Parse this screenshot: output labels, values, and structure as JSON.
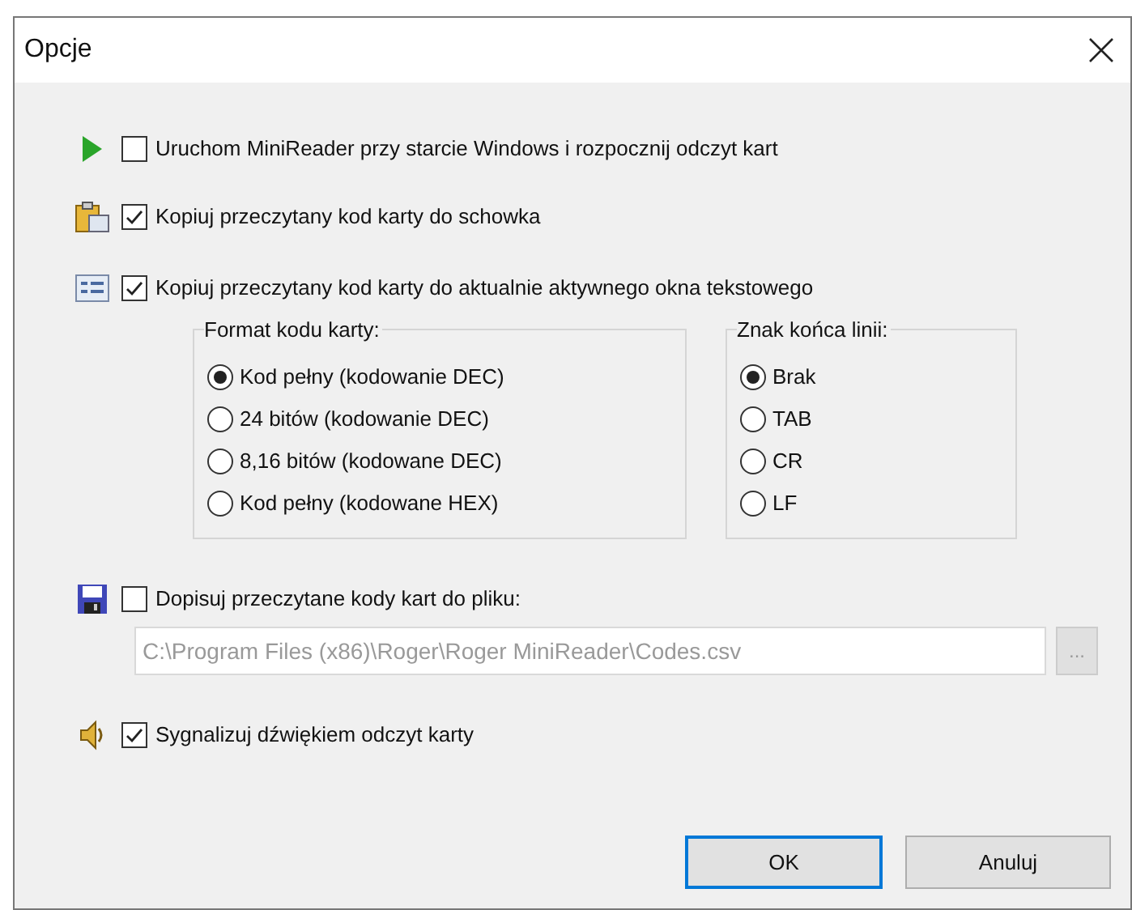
{
  "window": {
    "title": "Opcje"
  },
  "startup": {
    "label": "Uruchom MiniReader przy starcie Windows i rozpocznij odczyt kart",
    "checked": false
  },
  "clipboard": {
    "label": "Kopiuj przeczytany kod karty do schowka",
    "checked": true
  },
  "active_window": {
    "label": "Kopiuj przeczytany kod karty do aktualnie aktywnego okna tekstowego",
    "checked": true
  },
  "code_format": {
    "title": "Format kodu karty:",
    "options": [
      {
        "label": "Kod pełny (kodowanie DEC)",
        "selected": true
      },
      {
        "label": "24 bitów (kodowanie DEC)",
        "selected": false
      },
      {
        "label": "8,16 bitów (kodowane DEC)",
        "selected": false
      },
      {
        "label": "Kod pełny (kodowane HEX)",
        "selected": false
      }
    ]
  },
  "line_end": {
    "title": "Znak końca linii:",
    "options": [
      {
        "label": "Brak",
        "selected": true
      },
      {
        "label": "TAB",
        "selected": false
      },
      {
        "label": "CR",
        "selected": false
      },
      {
        "label": "LF",
        "selected": false
      }
    ]
  },
  "append_file": {
    "label": "Dopisuj przeczytane kody kart do pliku:",
    "checked": false,
    "path": "C:\\Program Files (x86)\\Roger\\Roger MiniReader\\Codes.csv",
    "disabled": true,
    "browse": "..."
  },
  "sound": {
    "label": "Sygnalizuj dźwiękiem odczyt karty",
    "checked": true
  },
  "buttons": {
    "ok": "OK",
    "cancel": "Anuluj"
  }
}
